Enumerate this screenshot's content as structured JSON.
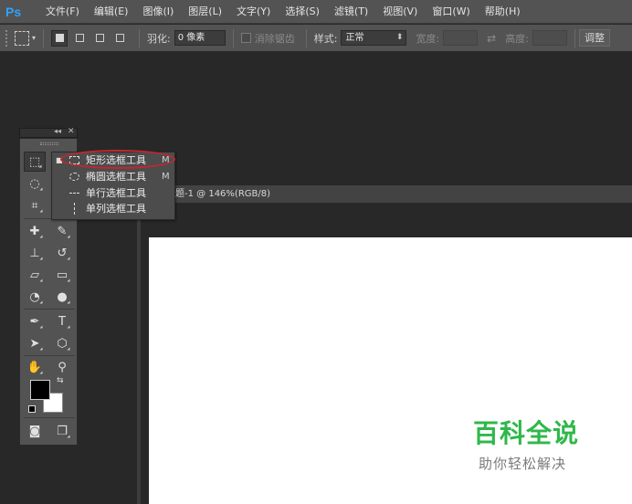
{
  "app": {
    "logo": "Ps"
  },
  "menu": [
    "文件(F)",
    "编辑(E)",
    "图像(I)",
    "图层(L)",
    "文字(Y)",
    "选择(S)",
    "滤镜(T)",
    "视图(V)",
    "窗口(W)",
    "帮助(H)"
  ],
  "options": {
    "feather_label": "羽化:",
    "feather_value": "0 像素",
    "antialias_label": "消除锯齿",
    "style_label": "样式:",
    "style_value": "正常",
    "width_label": "宽度:",
    "height_label": "高度:",
    "adjust_label": "调整"
  },
  "document": {
    "tab_title": "题-1 @ 146%(RGB/8)"
  },
  "flyout": {
    "items": [
      {
        "label": "矩形选框工具",
        "shortcut": "M",
        "icon": "rect-marquee-icon",
        "active": true
      },
      {
        "label": "椭圆选框工具",
        "shortcut": "M",
        "icon": "ellipse-marquee-icon",
        "active": false
      },
      {
        "label": "单行选框工具",
        "shortcut": "",
        "icon": "single-row-marquee-icon",
        "active": false
      },
      {
        "label": "单列选框工具",
        "shortcut": "",
        "icon": "single-column-marquee-icon",
        "active": false
      }
    ]
  },
  "tools_panel": {
    "collapse_glyph": "◂◂",
    "close_glyph": "✕",
    "swap_glyph": "⇆",
    "tools": [
      {
        "name": "marquee-tool-icon",
        "glyph": "⬚"
      },
      {
        "name": "lasso-tool-icon",
        "glyph": "◌"
      },
      {
        "name": "crop-tool-icon",
        "glyph": "⌗"
      },
      {
        "name": "healing-brush-icon",
        "glyph": "✚"
      },
      {
        "name": "brush-tool-icon",
        "glyph": "✎"
      },
      {
        "name": "stamp-tool-icon",
        "glyph": "⊥"
      },
      {
        "name": "history-brush-icon",
        "glyph": "↺"
      },
      {
        "name": "eraser-tool-icon",
        "glyph": "▱"
      },
      {
        "name": "gradient-tool-icon",
        "glyph": "▭"
      },
      {
        "name": "blur-tool-icon",
        "glyph": "◔"
      },
      {
        "name": "dodge-tool-icon",
        "glyph": "●"
      },
      {
        "name": "pen-tool-icon",
        "glyph": "✒"
      },
      {
        "name": "type-tool-icon",
        "glyph": "T"
      },
      {
        "name": "path-selection-icon",
        "glyph": "➤"
      },
      {
        "name": "shape-tool-icon",
        "glyph": "⬡"
      },
      {
        "name": "hand-tool-icon",
        "glyph": "✋"
      },
      {
        "name": "zoom-tool-icon",
        "glyph": "⚲"
      },
      {
        "name": "quick-mask-icon",
        "glyph": "◙"
      },
      {
        "name": "screen-mode-icon",
        "glyph": "❐"
      }
    ]
  },
  "watermark": {
    "title": "百科全说",
    "subtitle": "助你轻松解决"
  }
}
